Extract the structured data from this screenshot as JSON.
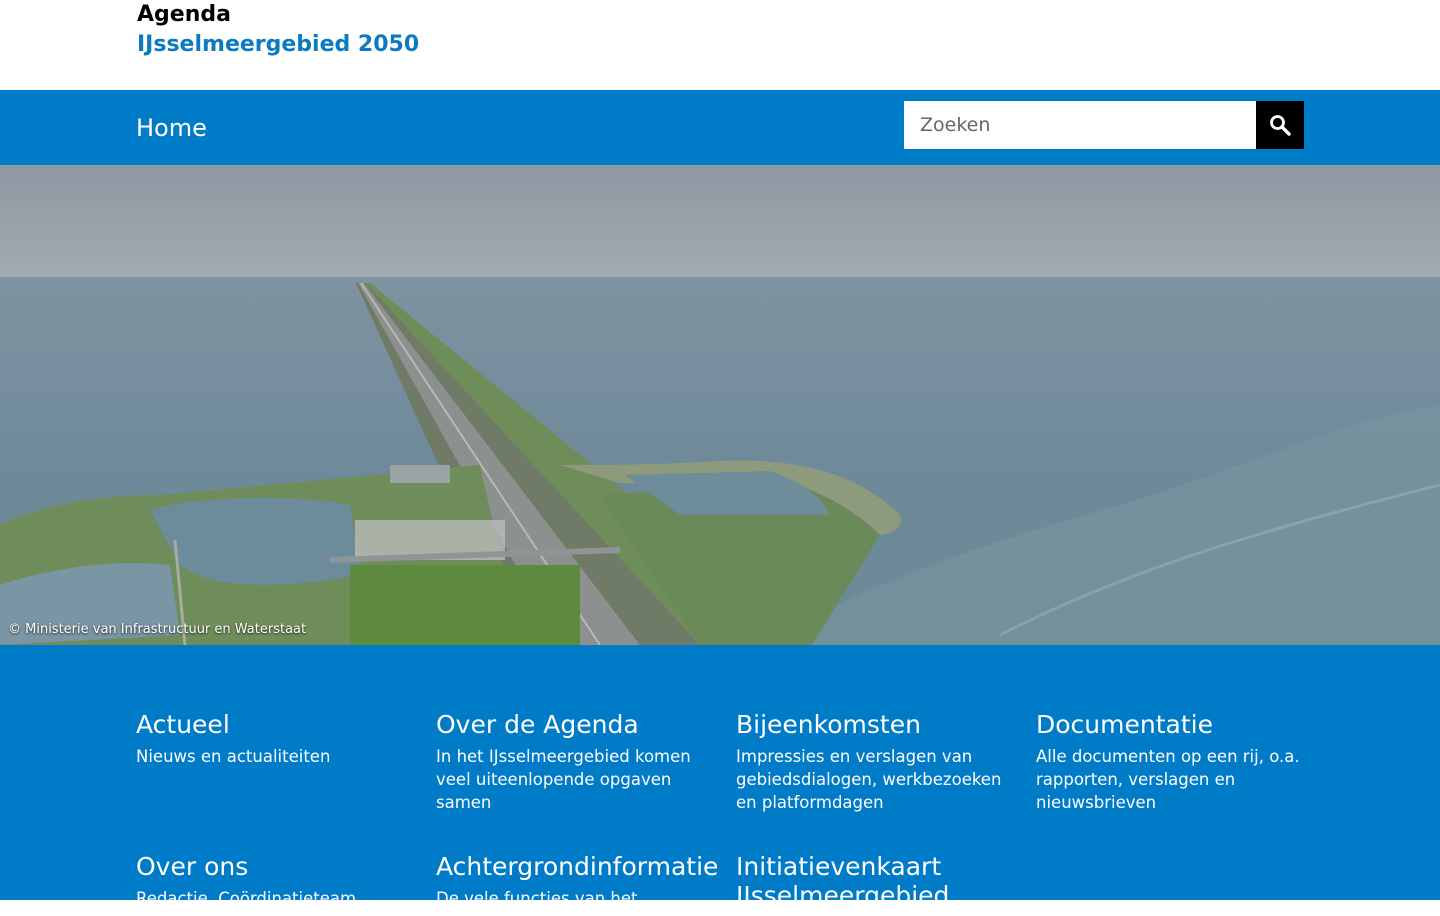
{
  "header": {
    "brand_line1": "Agenda",
    "brand_line2": "IJsselmeergebied 2050"
  },
  "nav": {
    "home_label": "Home"
  },
  "search": {
    "placeholder": "Zoeken",
    "button_icon": "search-icon"
  },
  "hero": {
    "credit": "© Ministerie van Infrastructuur en Waterstaat"
  },
  "tiles": [
    {
      "title": "Actueel",
      "description": "Nieuws en actualiteiten"
    },
    {
      "title": "Over de Agenda",
      "description": "In het IJsselmeergebied komen veel uiteenlopende opgaven samen"
    },
    {
      "title": "Bijeenkomsten",
      "description": "Impressies en verslagen van gebiedsdialogen, werkbezoeken en platformdagen"
    },
    {
      "title": "Documentatie",
      "description": "Alle documenten op een rij, o.a. rapporten, verslagen en nieuwsbrieven"
    },
    {
      "title": "Over ons",
      "description": "Redactie, Coördinatieteam"
    },
    {
      "title": "Achtergrondinformatie",
      "description": "De vele functies van het"
    },
    {
      "title": "Initiatievenkaart IJsselmeergebied",
      "description": ""
    }
  ],
  "colors": {
    "brand_blue": "#007bc7",
    "brand_text_blue": "#0b7bc1",
    "search_button": "#000000"
  }
}
